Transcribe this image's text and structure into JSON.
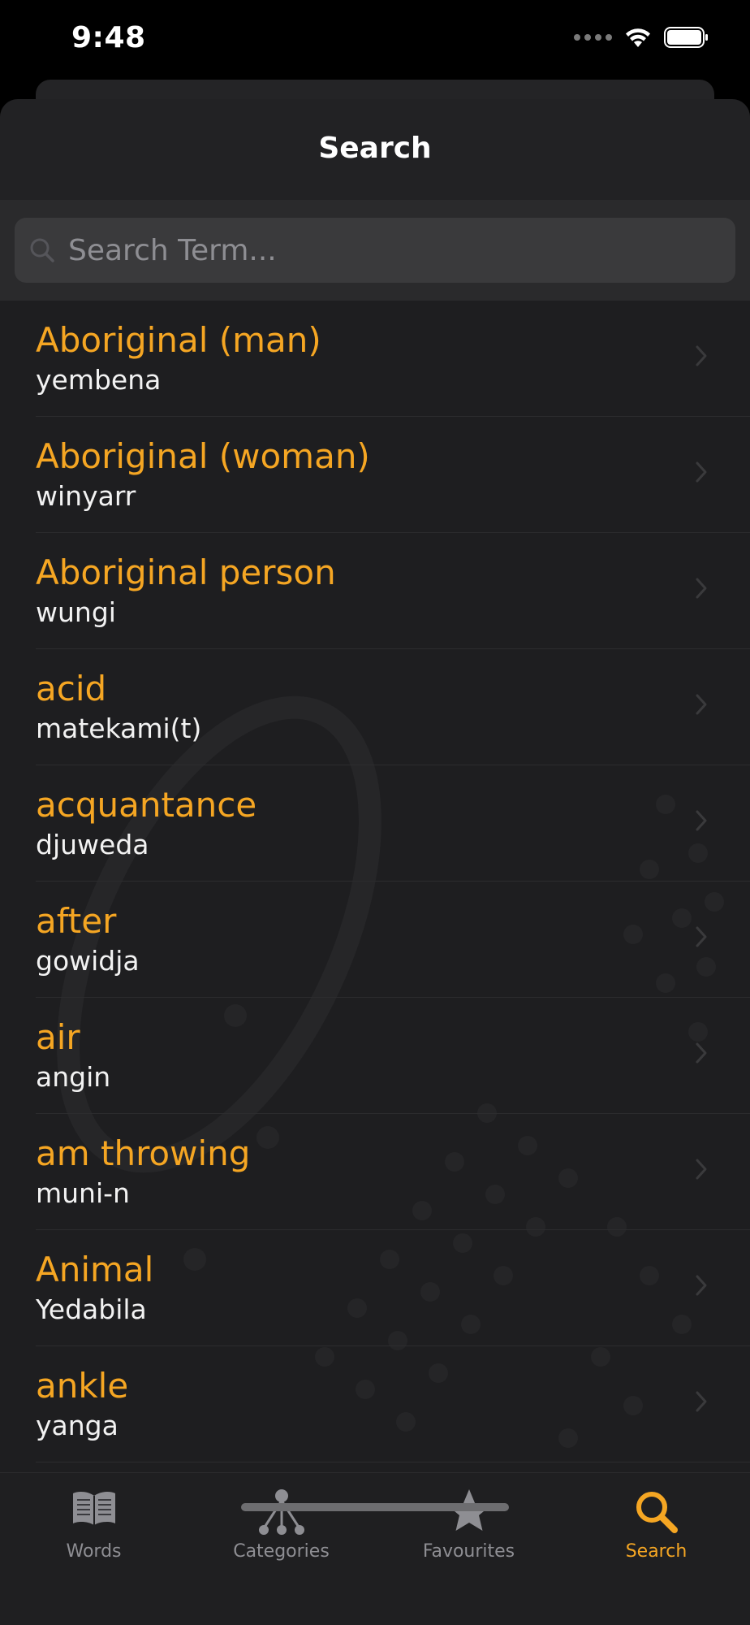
{
  "status_bar": {
    "time": "9:48"
  },
  "nav": {
    "title": "Search"
  },
  "search": {
    "placeholder": "Search Term..."
  },
  "list": {
    "items": [
      {
        "term": "Aboriginal (man)",
        "translation": "yembena"
      },
      {
        "term": "Aboriginal (woman)",
        "translation": "winyarr"
      },
      {
        "term": "Aboriginal person",
        "translation": "wungi"
      },
      {
        "term": "acid",
        "translation": "matekami(t)"
      },
      {
        "term": "acquantance",
        "translation": "djuweda"
      },
      {
        "term": "after",
        "translation": "gowidja"
      },
      {
        "term": "air",
        "translation": "angin"
      },
      {
        "term": "am throwing",
        "translation": "muni-n"
      },
      {
        "term": "Animal",
        "translation": "Yedabila"
      },
      {
        "term": "ankle",
        "translation": "yanga"
      }
    ]
  },
  "tabbar": {
    "tabs": [
      {
        "label": "Words",
        "icon": "book-icon"
      },
      {
        "label": "Categories",
        "icon": "network-icon"
      },
      {
        "label": "Favourites",
        "icon": "star-icon"
      },
      {
        "label": "Search",
        "icon": "magnifier-icon"
      }
    ],
    "active": "Search"
  },
  "colors": {
    "accent": "#f5a623",
    "background": "#1c1c1e",
    "inactive_tab": "#8e8e93"
  }
}
